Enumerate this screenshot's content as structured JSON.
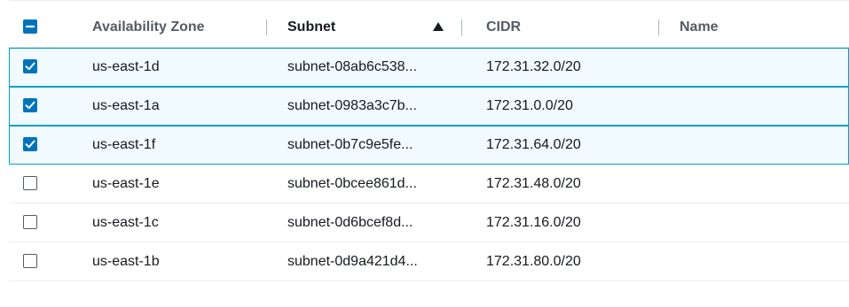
{
  "header": {
    "columns": [
      "Availability Zone",
      "Subnet",
      "CIDR",
      "Name"
    ],
    "sorted_column": "Subnet",
    "sort_direction": "ascending",
    "select_all_state": "indeterminate"
  },
  "rows": [
    {
      "az": "us-east-1d",
      "subnet": "subnet-08ab6c538...",
      "cidr": "172.31.32.0/20",
      "name": "",
      "selected": true
    },
    {
      "az": "us-east-1a",
      "subnet": "subnet-0983a3c7b...",
      "cidr": "172.31.0.0/20",
      "name": "",
      "selected": true
    },
    {
      "az": "us-east-1f",
      "subnet": "subnet-0b7c9e5fe...",
      "cidr": "172.31.64.0/20",
      "name": "",
      "selected": true
    },
    {
      "az": "us-east-1e",
      "subnet": "subnet-0bcee861d...",
      "cidr": "172.31.48.0/20",
      "name": "",
      "selected": false
    },
    {
      "az": "us-east-1c",
      "subnet": "subnet-0d6bcef8d...",
      "cidr": "172.31.16.0/20",
      "name": "",
      "selected": false
    },
    {
      "az": "us-east-1b",
      "subnet": "subnet-0d9a421d4...",
      "cidr": "172.31.80.0/20",
      "name": "",
      "selected": false
    }
  ],
  "colors": {
    "accent": "#0073bb",
    "selected_row_bg": "#f1faff",
    "selected_row_border": "#00a1c9"
  },
  "icons": {
    "select_all": "checkbox-indeterminate-icon",
    "sort": "sort-ascending-icon",
    "row_checked": "checkbox-checked-icon",
    "row_unchecked": "checkbox-unchecked-icon"
  }
}
